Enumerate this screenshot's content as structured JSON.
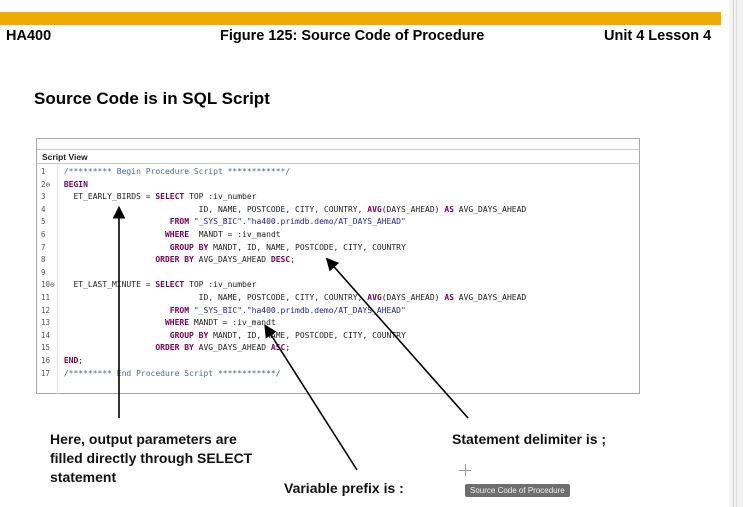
{
  "header": {
    "course": "HA400",
    "figure": "Figure 125: Source Code of Procedure",
    "unit": "Unit 4 Lesson 4"
  },
  "slide_title": "Source Code is in SQL Script",
  "script_view": {
    "title": "Script View",
    "lines": [
      {
        "num": "1",
        "parts": [
          {
            "t": " /********* Begin Procedure Script ************/",
            "c": "cm"
          }
        ]
      },
      {
        "num": "2",
        "marker": "⊖",
        "parts": [
          {
            "t": " BEGIN",
            "c": "kw"
          }
        ]
      },
      {
        "num": "3",
        "parts": [
          {
            "t": "   ET_EARLY_BIRDS = ",
            "c": ""
          },
          {
            "t": "SELECT",
            "c": "kw"
          },
          {
            "t": " TOP :iv_number",
            "c": ""
          }
        ]
      },
      {
        "num": "4",
        "parts": [
          {
            "t": "                             ID, NAME, POSTCODE, CITY, COUNTRY, ",
            "c": ""
          },
          {
            "t": "AVG",
            "c": "kw"
          },
          {
            "t": "(DAYS_AHEAD) ",
            "c": ""
          },
          {
            "t": "AS",
            "c": "kw"
          },
          {
            "t": " AVG_DAYS_AHEAD",
            "c": ""
          }
        ]
      },
      {
        "num": "5",
        "parts": [
          {
            "t": "                       ",
            "c": ""
          },
          {
            "t": "FROM",
            "c": "kw"
          },
          {
            "t": " \"_SYS_BIC\".\"ha400.primdb.demo/AT_DAYS_AHEAD\"",
            "c": "st"
          }
        ]
      },
      {
        "num": "6",
        "parts": [
          {
            "t": "                      ",
            "c": ""
          },
          {
            "t": "WHERE",
            "c": "kw"
          },
          {
            "t": "  MANDT = :iv_mandt",
            "c": ""
          }
        ]
      },
      {
        "num": "7",
        "parts": [
          {
            "t": "                       ",
            "c": ""
          },
          {
            "t": "GROUP BY",
            "c": "kw"
          },
          {
            "t": " MANDT, ID, NAME, POSTCODE, CITY, COUNTRY",
            "c": ""
          }
        ]
      },
      {
        "num": "8",
        "parts": [
          {
            "t": "                    ",
            "c": ""
          },
          {
            "t": "ORDER BY",
            "c": "kw"
          },
          {
            "t": " AVG_DAYS_AHEAD ",
            "c": ""
          },
          {
            "t": "DESC",
            "c": "kw"
          },
          {
            "t": ";",
            "c": ""
          }
        ]
      },
      {
        "num": "9",
        "parts": [
          {
            "t": "",
            "c": ""
          }
        ]
      },
      {
        "num": "10",
        "marker": "⊖",
        "parts": [
          {
            "t": "   ET_LAST_MINUTE = ",
            "c": ""
          },
          {
            "t": "SELECT",
            "c": "kw"
          },
          {
            "t": " TOP :iv_number",
            "c": ""
          }
        ]
      },
      {
        "num": "11",
        "parts": [
          {
            "t": "                             ID, NAME, POSTCODE, CITY, COUNTRY, ",
            "c": ""
          },
          {
            "t": "AVG",
            "c": "kw"
          },
          {
            "t": "(DAYS_AHEAD) ",
            "c": ""
          },
          {
            "t": "AS",
            "c": "kw"
          },
          {
            "t": " AVG_DAYS_AHEAD",
            "c": ""
          }
        ]
      },
      {
        "num": "12",
        "parts": [
          {
            "t": "                       ",
            "c": ""
          },
          {
            "t": "FROM",
            "c": "kw"
          },
          {
            "t": " \"_SYS_BIC\".\"ha400.primdb.demo/AT_DAYS_AHEAD\"",
            "c": "st"
          }
        ]
      },
      {
        "num": "13",
        "parts": [
          {
            "t": "                      ",
            "c": ""
          },
          {
            "t": "WHERE",
            "c": "kw"
          },
          {
            "t": " MANDT = :iv_mandt",
            "c": ""
          }
        ]
      },
      {
        "num": "14",
        "parts": [
          {
            "t": "                       ",
            "c": ""
          },
          {
            "t": "GROUP BY",
            "c": "kw"
          },
          {
            "t": " MANDT, ID, NAME, POSTCODE, CITY, COUNTRY",
            "c": ""
          }
        ]
      },
      {
        "num": "15",
        "parts": [
          {
            "t": "                    ",
            "c": ""
          },
          {
            "t": "ORDER BY",
            "c": "kw"
          },
          {
            "t": " AVG_DAYS_AHEAD ",
            "c": ""
          },
          {
            "t": "ASC",
            "c": "kw"
          },
          {
            "t": ";",
            "c": ""
          }
        ]
      },
      {
        "num": "16",
        "parts": [
          {
            "t": " END",
            "c": "kw"
          },
          {
            "t": ";",
            "c": ""
          }
        ]
      },
      {
        "num": "17",
        "parts": [
          {
            "t": " /********* End Procedure Script ************/",
            "c": "cm"
          }
        ]
      }
    ]
  },
  "callouts": {
    "output_params": "Here, output parameters are filled directly through SELECT statement",
    "variable_prefix": "Variable prefix is :",
    "statement_delimiter": "Statement delimiter is ;"
  },
  "tooltip": "Source Code of Procedure",
  "colors": {
    "accent_bar": "#f0ab00",
    "keyword": "#7a0055",
    "comment": "#4d6a8a",
    "string": "#2222aa"
  }
}
